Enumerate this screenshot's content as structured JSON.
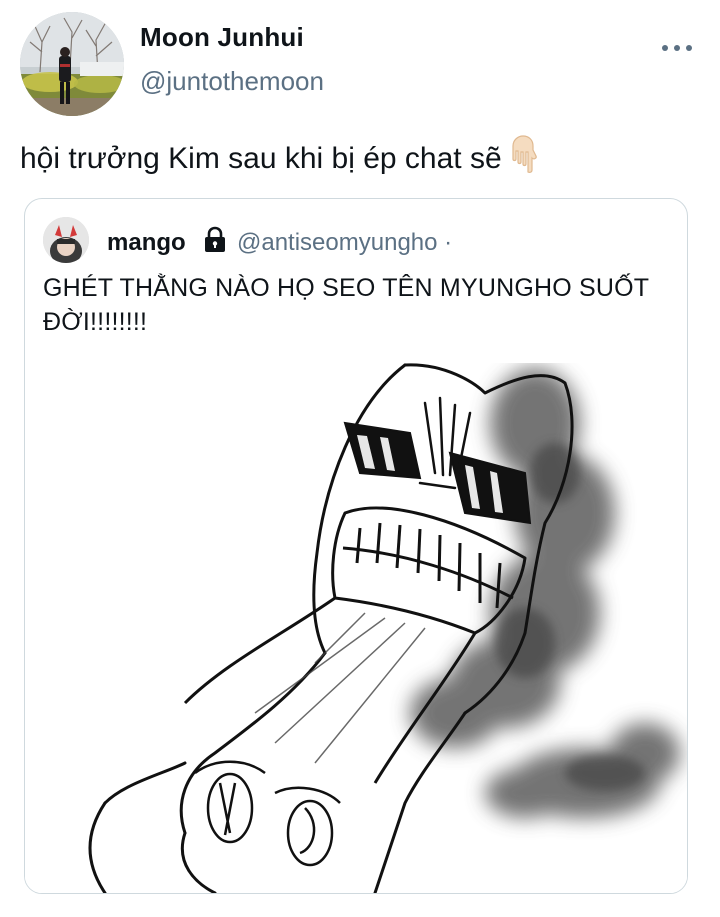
{
  "author": {
    "display_name": "Moon Junhui",
    "handle": "@juntothemoon"
  },
  "tweet": {
    "text": "hội trưởng Kim sau khi bị ép chat sẽ",
    "emoji": "backhand-index-pointing-down"
  },
  "quoted_tweet": {
    "display_name": "mango",
    "protected_icon": "lock-icon",
    "handle": "@antiseomyungho ·",
    "text": "GHÉT THẰNG NÀO HỌ SEO TÊN MYUNGHO SUỐT ĐỜI!!!!!!!!",
    "media": "angry-cartoon-sketch"
  },
  "colors": {
    "text_primary": "#0f1419",
    "text_secondary": "#5b7083",
    "border": "#cfd9de"
  }
}
